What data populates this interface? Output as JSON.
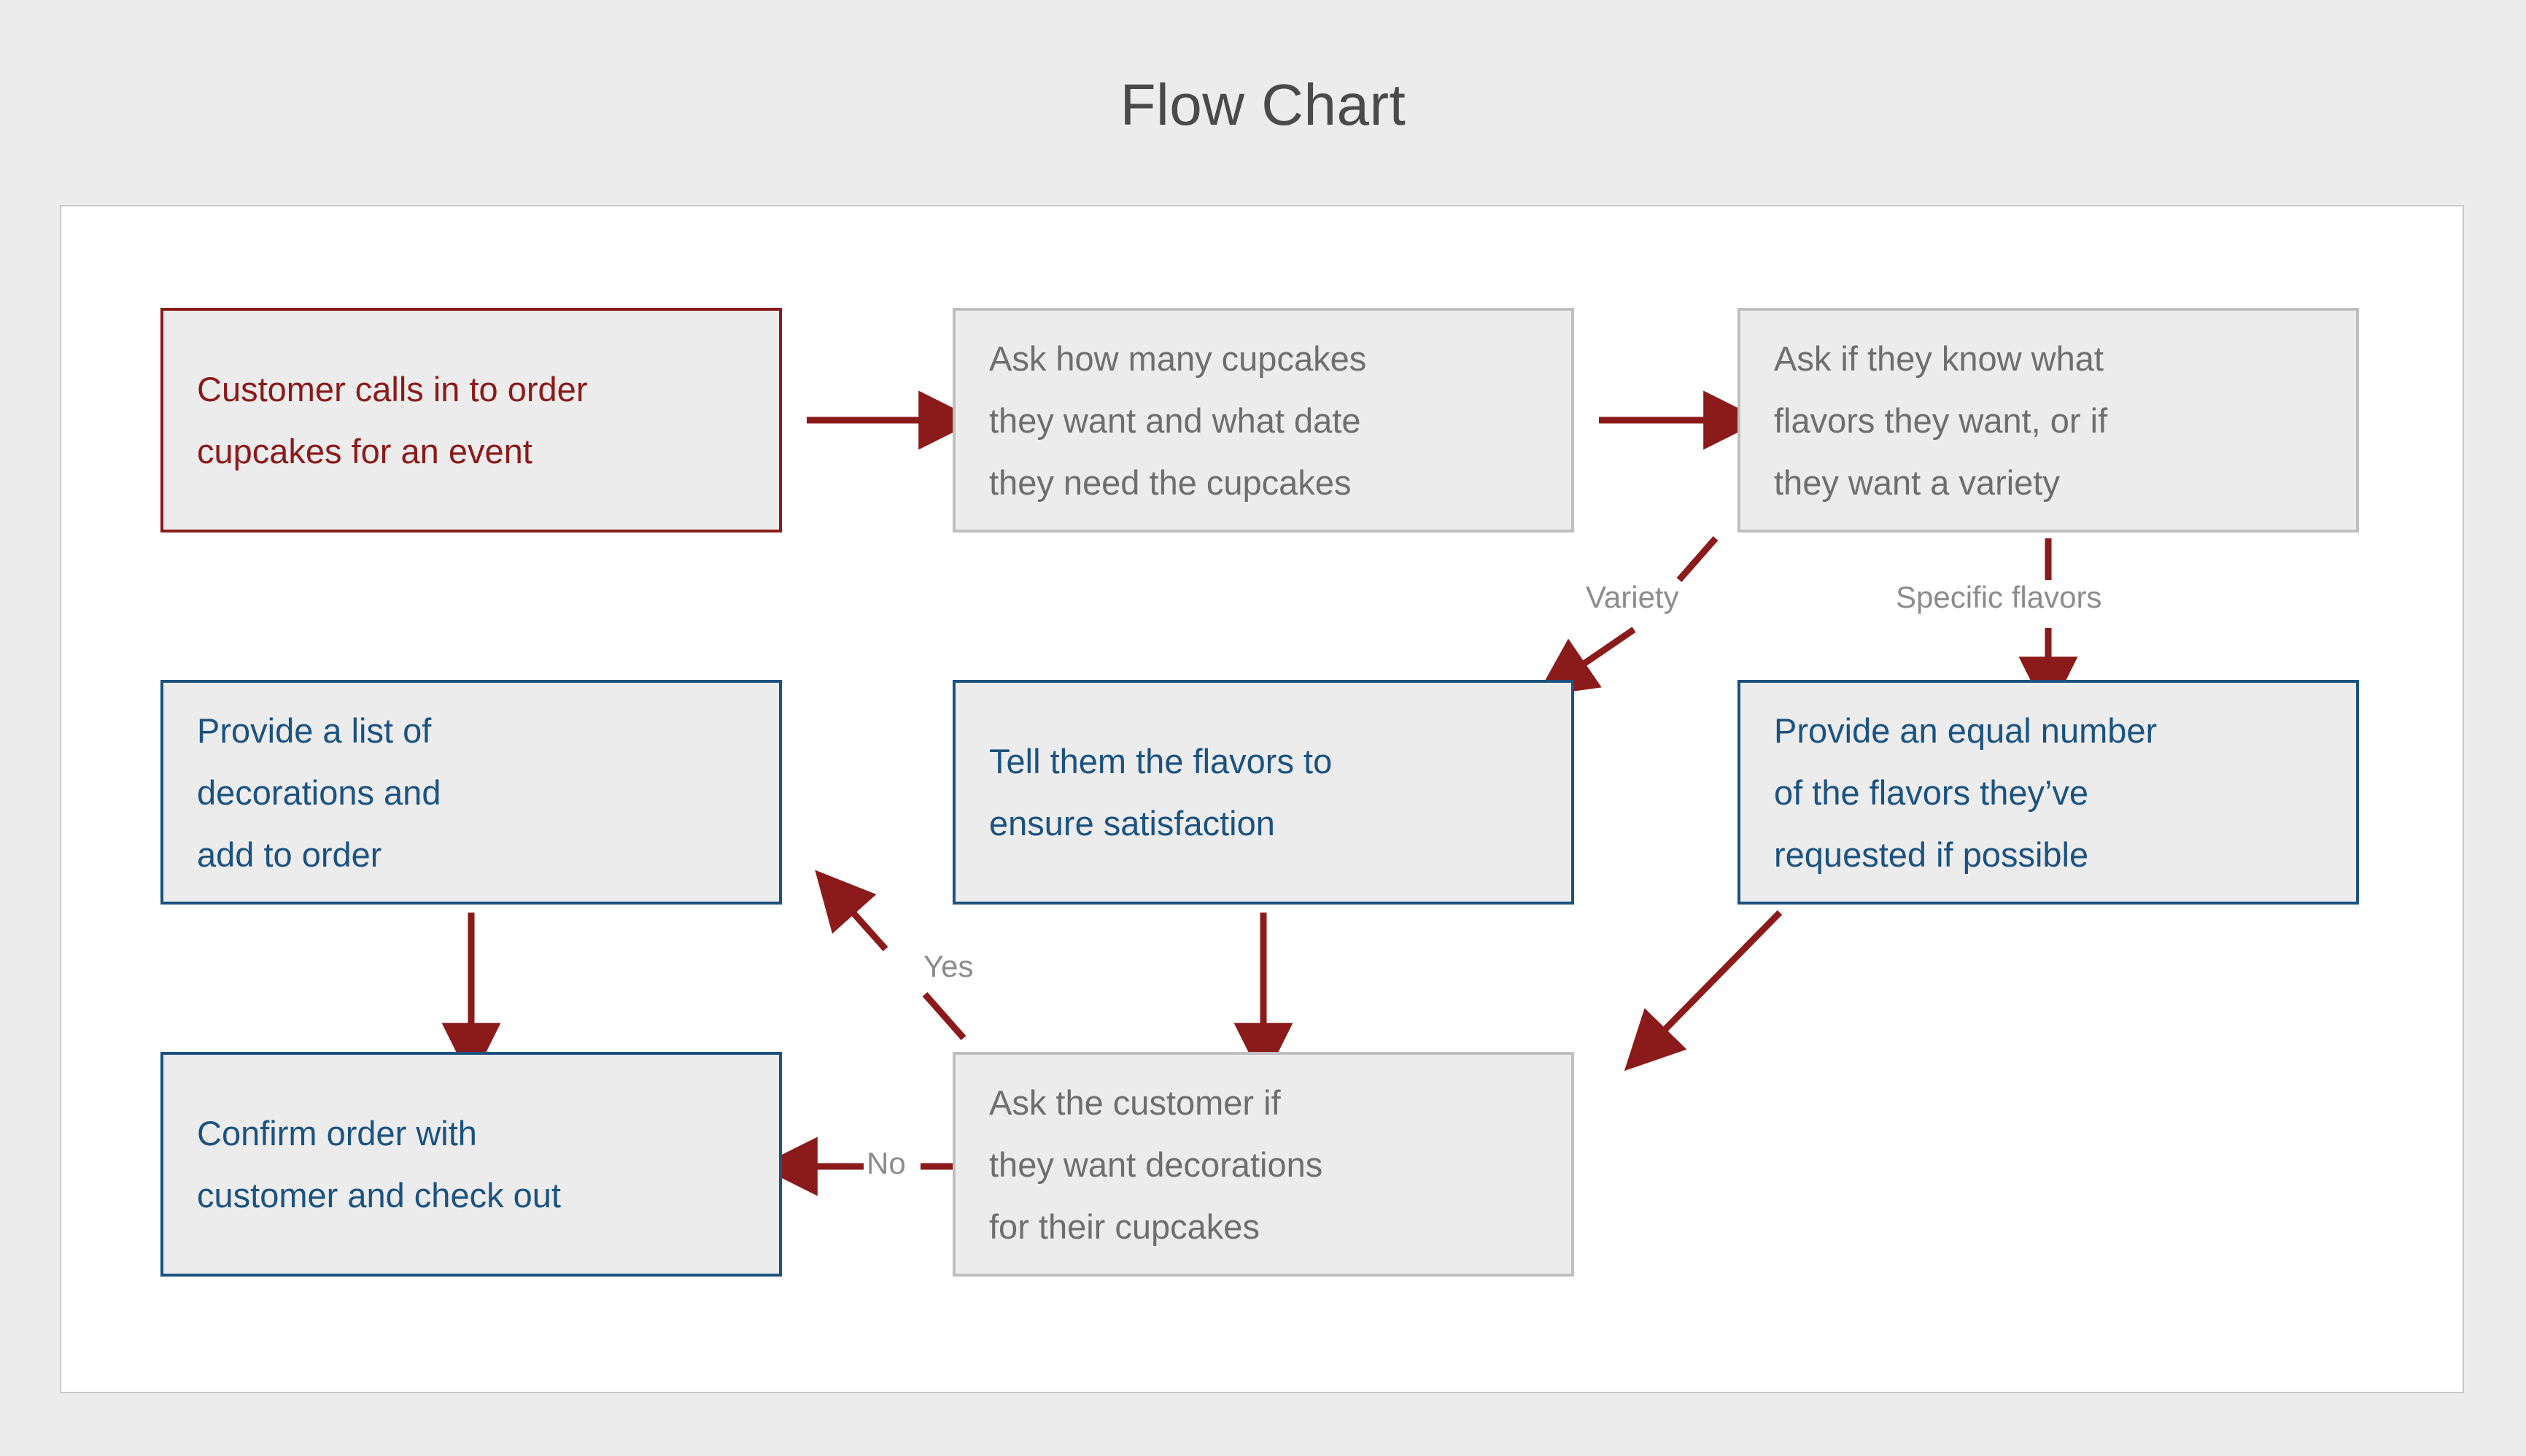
{
  "title": "Flow Chart",
  "colors": {
    "page_background": "#ECECEC",
    "canvas_background": "#FFFFFF",
    "canvas_border": "#C8C8C8",
    "title_text": "#4A4A4A",
    "start_border": "#8B1A1A",
    "start_text": "#8B1A1A",
    "process_border": "#BFBFBF",
    "process_text": "#6E6E6E",
    "action_border": "#1B5280",
    "action_text": "#1B5280",
    "node_fill": "#ECECEC",
    "arrow": "#8B1A1A",
    "edge_label_text": "#8C8C8C"
  },
  "chart_data": {
    "type": "diagram",
    "title": "Flow Chart",
    "nodes": [
      {
        "id": "start",
        "lines": [
          "Customer calls in to order",
          "cupcakes for an event"
        ],
        "style": "maroon",
        "column": 1,
        "row": 1
      },
      {
        "id": "ask_quantity",
        "lines": [
          "Ask how many cupcakes",
          "they want and what date",
          "they need the cupcakes"
        ],
        "style": "gray",
        "column": 2,
        "row": 1
      },
      {
        "id": "ask_flavors",
        "lines": [
          "Ask if they know what",
          "flavors they want, or if",
          "they want a variety"
        ],
        "style": "gray",
        "column": 3,
        "row": 1
      },
      {
        "id": "list_decorations",
        "lines": [
          "Provide a list of",
          "decorations and",
          "add to order"
        ],
        "style": "blue",
        "column": 1,
        "row": 2
      },
      {
        "id": "tell_flavors",
        "lines": [
          "Tell them the flavors to",
          "ensure satisfaction"
        ],
        "style": "blue",
        "column": 2,
        "row": 2
      },
      {
        "id": "equal_number",
        "lines": [
          "Provide an equal number",
          "of the flavors they’ve",
          "requested if possible"
        ],
        "style": "blue",
        "column": 3,
        "row": 2
      },
      {
        "id": "confirm_order",
        "lines": [
          "Confirm order with",
          "customer and check out"
        ],
        "style": "blue",
        "column": 1,
        "row": 3
      },
      {
        "id": "ask_decorations",
        "lines": [
          "Ask the customer if",
          "they want decorations",
          "for their cupcakes"
        ],
        "style": "gray",
        "column": 2,
        "row": 3
      }
    ],
    "edges": [
      {
        "from": "start",
        "to": "ask_quantity",
        "label": "",
        "direction": "right"
      },
      {
        "from": "ask_quantity",
        "to": "ask_flavors",
        "label": "",
        "direction": "right"
      },
      {
        "from": "ask_flavors",
        "to": "tell_flavors",
        "label": "Variety",
        "direction": "down-left"
      },
      {
        "from": "ask_flavors",
        "to": "equal_number",
        "label": "Specific flavors",
        "direction": "down"
      },
      {
        "from": "equal_number",
        "to": "ask_decorations",
        "label": "",
        "direction": "down-left"
      },
      {
        "from": "tell_flavors",
        "to": "ask_decorations",
        "label": "",
        "direction": "down"
      },
      {
        "from": "ask_decorations",
        "to": "list_decorations",
        "label": "Yes",
        "direction": "up-left"
      },
      {
        "from": "ask_decorations",
        "to": "confirm_order",
        "label": "No",
        "direction": "left"
      },
      {
        "from": "list_decorations",
        "to": "confirm_order",
        "label": "",
        "direction": "down"
      }
    ],
    "edge_labels": [
      "Variety",
      "Specific flavors",
      "Yes",
      "No"
    ]
  }
}
